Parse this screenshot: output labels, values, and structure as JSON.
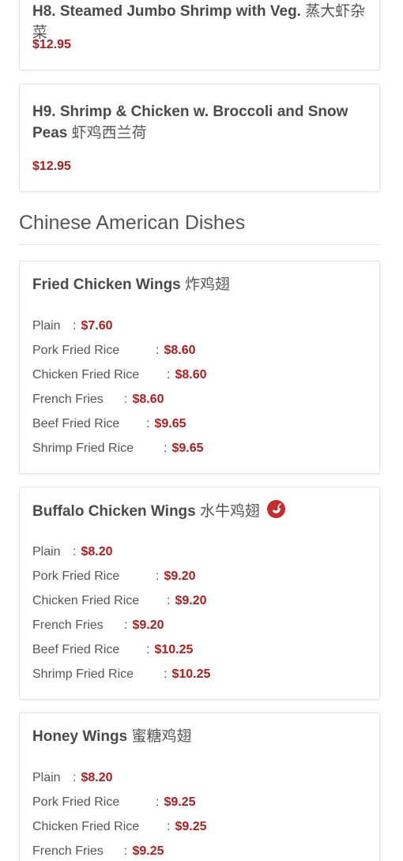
{
  "h8": {
    "name": "H8. Steamed Jumbo Shrimp with Veg.",
    "cjk": "蒸大虾杂菜",
    "price": "$12.95"
  },
  "h9": {
    "name_line1": "H9. Shrimp & Chicken w. Broccoli and Snow",
    "name_line2": "Peas",
    "cjk": "虾鸡西兰荷",
    "price": "$12.95"
  },
  "section": {
    "title": "Chinese American Dishes"
  },
  "fried_wings": {
    "name": "Fried Chicken Wings",
    "cjk": "炸鸡翅",
    "options": [
      {
        "label": "Plain",
        "price": "$7.60"
      },
      {
        "label": "Pork Fried Rice",
        "price": "$8.60"
      },
      {
        "label": "Chicken Fried Rice",
        "price": "$8.60"
      },
      {
        "label": "French Fries",
        "price": "$8.60"
      },
      {
        "label": "Beef Fried Rice",
        "price": "$9.65"
      },
      {
        "label": "Shrimp Fried Rice",
        "price": "$9.65"
      }
    ]
  },
  "buffalo_wings": {
    "name": "Buffalo Chicken Wings",
    "cjk": "水牛鸡翅",
    "spicy_icon": "chili-pepper-icon",
    "options": [
      {
        "label": "Plain",
        "price": "$8.20"
      },
      {
        "label": "Pork Fried Rice",
        "price": "$9.20"
      },
      {
        "label": "Chicken Fried Rice",
        "price": "$9.20"
      },
      {
        "label": "French Fries",
        "price": "$9.20"
      },
      {
        "label": "Beef Fried Rice",
        "price": "$10.25"
      },
      {
        "label": "Shrimp Fried Rice",
        "price": "$10.25"
      }
    ]
  },
  "honey_wings": {
    "name": "Honey Wings",
    "cjk": "蜜糖鸡翅",
    "options": [
      {
        "label": "Plain",
        "price": "$8.20"
      },
      {
        "label": "Pork Fried Rice",
        "price": "$9.25"
      },
      {
        "label": "Chicken Fried Rice",
        "price": "$9.25"
      },
      {
        "label": "French Fries",
        "price": "$9.25"
      }
    ]
  },
  "colors": {
    "price": "#b01c1c",
    "spicy": "#c62b2b"
  }
}
